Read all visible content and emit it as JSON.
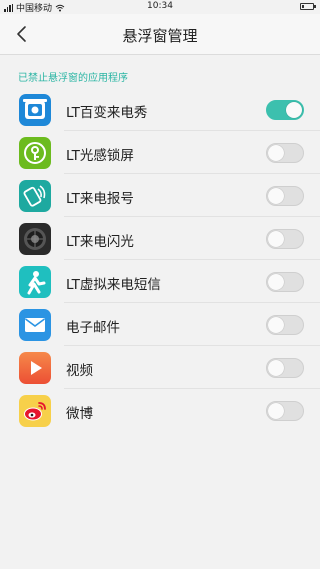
{
  "status_bar": {
    "carrier": "中国移动",
    "time": "10:34",
    "battery_level_percent": 20
  },
  "header": {
    "title": "悬浮窗管理",
    "back_icon": "chevron-left-icon"
  },
  "section": {
    "label": "已禁止悬浮窗的应用程序"
  },
  "apps": [
    {
      "label": "LT百变来电秀",
      "enabled": true,
      "icon": "lt-baibian-icon",
      "color": "#1e88d8"
    },
    {
      "label": "LT光感锁屏",
      "enabled": false,
      "icon": "lt-lock-icon",
      "color": "#6cbb1e"
    },
    {
      "label": "LT来电报号",
      "enabled": false,
      "icon": "lt-caller-id-icon",
      "color": "#1ea9a0"
    },
    {
      "label": "LT来电闪光",
      "enabled": false,
      "icon": "lt-flash-icon",
      "color": "#2a2a2a"
    },
    {
      "label": "LT虚拟来电短信",
      "enabled": false,
      "icon": "lt-virtual-call-icon",
      "color": "#1fbfbf"
    },
    {
      "label": "电子邮件",
      "enabled": false,
      "icon": "email-icon",
      "color": "#2b94e3"
    },
    {
      "label": "视频",
      "enabled": false,
      "icon": "video-icon",
      "color": "#f06a3a"
    },
    {
      "label": "微博",
      "enabled": false,
      "icon": "weibo-icon",
      "color": "#f7d04a"
    }
  ],
  "colors": {
    "accent": "#3cc0ae",
    "section_label": "#2bb5a4",
    "toggle_off": "#e0e0e0"
  }
}
